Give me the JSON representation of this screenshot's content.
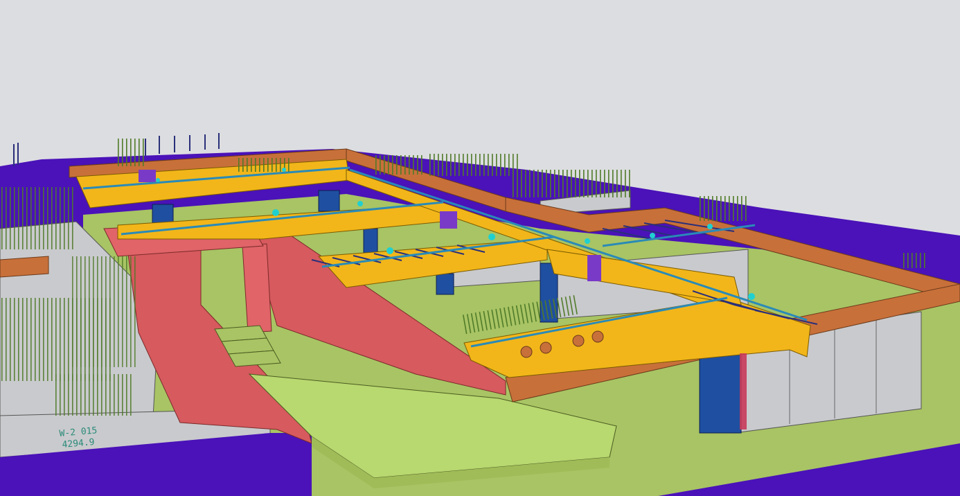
{
  "scene": {
    "kind": "3d-structural-model-view",
    "background": "#dcdde0",
    "colors": {
      "slab_floor": "#a8c464",
      "slab_edge": "#b8d870",
      "wall_red": "#d65a5e",
      "wall_red_dark": "#b94a50",
      "beam_yellow": "#f2b61a",
      "beam_orange": "#c8703a",
      "column_blue": "#1f4fa0",
      "base_purple": "#4a12b8",
      "wall_grey": "#c9cacd",
      "rebar_green": "#4f7a28",
      "rebar_navy": "#2a2f7a",
      "rebar_teal": "#2a8ab8",
      "marker_cyan": "#20d0d0",
      "void_circle": "#c8703a"
    }
  },
  "labels": {
    "wall_tag": "W-2 015",
    "wall_elevation": "4294.9"
  }
}
